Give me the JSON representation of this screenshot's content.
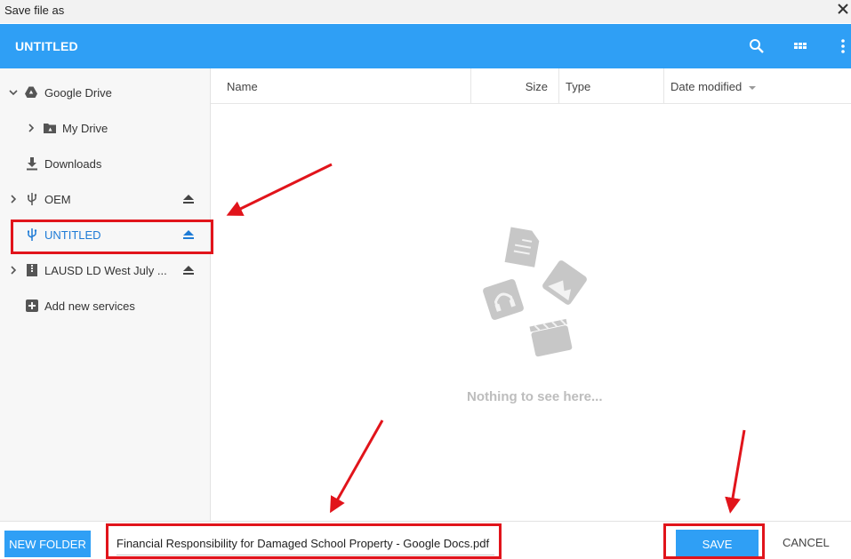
{
  "window": {
    "title": "Save file as"
  },
  "header": {
    "title": "UNTITLED"
  },
  "sidebar": {
    "items": [
      {
        "label": "Google Drive",
        "icon": "google-drive-icon",
        "expand": "chevron-down"
      },
      {
        "label": "My Drive",
        "icon": "drive-folder-icon",
        "expand": "chevron-right"
      },
      {
        "label": "Downloads",
        "icon": "download-icon",
        "expand": ""
      },
      {
        "label": "OEM",
        "icon": "usb-icon",
        "expand": "chevron-right",
        "eject": true
      },
      {
        "label": "UNTITLED",
        "icon": "usb-icon",
        "expand": "",
        "eject": true,
        "active": true
      },
      {
        "label": "LAUSD LD West July ...",
        "icon": "archive-icon",
        "expand": "chevron-right",
        "eject": true
      },
      {
        "label": "Add new services",
        "icon": "add-box-icon",
        "expand": ""
      }
    ]
  },
  "columns": {
    "name": "Name",
    "size": "Size",
    "type": "Type",
    "date": "Date modified"
  },
  "empty": {
    "message": "Nothing to see here..."
  },
  "footer": {
    "new_folder": "NEW FOLDER",
    "filename": "Financial Responsibility for Damaged School Property - Google Docs.pdf",
    "save": "SAVE",
    "cancel": "CANCEL"
  },
  "colors": {
    "accent": "#2f9ff5",
    "active_text": "#1e7bd6",
    "annotation": "#e1141b"
  }
}
